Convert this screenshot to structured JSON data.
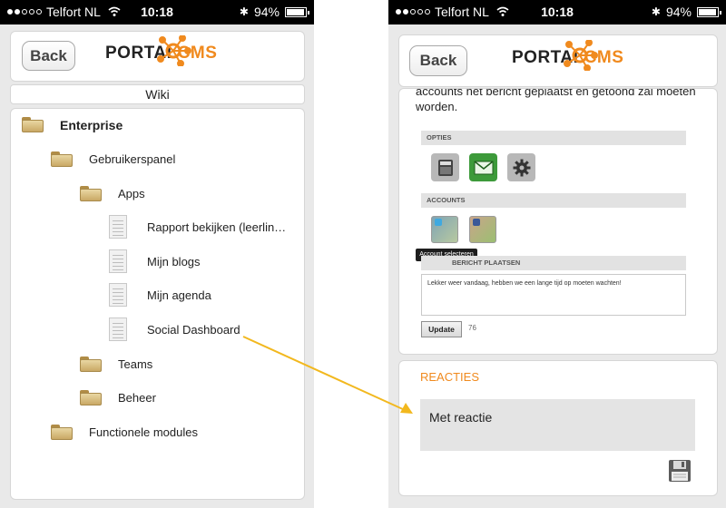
{
  "status": {
    "carrier": "Telfort NL",
    "time": "10:18",
    "battery": "94%",
    "battery_level": 0.94
  },
  "left": {
    "back_label": "Back",
    "logo_text": "PORTAL",
    "logo_cms": "CMS",
    "wiki_title": "Wiki",
    "tree": [
      {
        "label": "Enterprise",
        "type": "folder",
        "bold": true
      },
      {
        "label": "Gebruikerspanel",
        "type": "folder"
      },
      {
        "label": "Apps",
        "type": "folder"
      },
      {
        "label": "Rapport bekijken (leerlin…",
        "type": "doc"
      },
      {
        "label": "Mijn blogs",
        "type": "doc"
      },
      {
        "label": "Mijn agenda",
        "type": "doc"
      },
      {
        "label": "Social Dashboard",
        "type": "doc"
      },
      {
        "label": "Teams",
        "type": "folder"
      },
      {
        "label": "Beheer",
        "type": "folder"
      },
      {
        "label": "Functionele modules",
        "type": "folder"
      }
    ]
  },
  "right": {
    "back_label": "Back",
    "logo_text": "PORTAL",
    "logo_cms": "CMS",
    "truncated_text": "accounts het bericht geplaatst en getoond zal moeten worden.",
    "opties_label": "OPTIES",
    "accounts_label": "ACCOUNTS",
    "tooltip": "Account selecteren",
    "bericht_label": "BERICHT PLAATSEN",
    "post_text": "Lekker weer vandaag, hebben we een lange tijd op moeten wachten!",
    "update_label": "Update",
    "update_count": "76",
    "reacties_title": "REACTIES",
    "reactie_text": "Met reactie"
  },
  "colors": {
    "accent": "#f08a1e",
    "arrow": "#f2b81e",
    "mail_green": "#3d9a3a"
  }
}
